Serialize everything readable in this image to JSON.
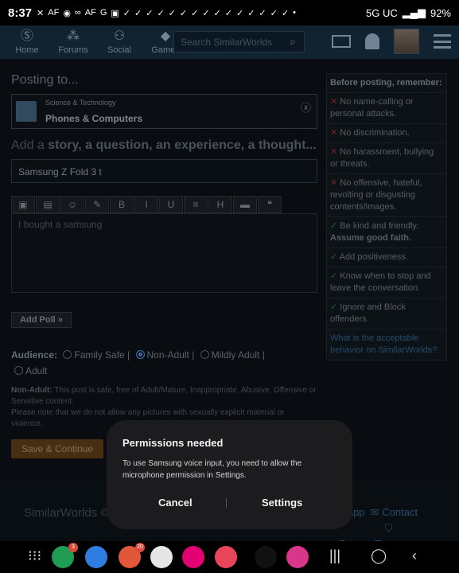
{
  "status_bar": {
    "time": "8:37",
    "notif_icons": [
      "✕",
      "AF",
      "◉",
      "∞",
      "AF",
      "G",
      "▣",
      "✓",
      "✓",
      "✓",
      "✓",
      "✓",
      "✓",
      "✓",
      "✓",
      "✓",
      "✓",
      "✓",
      "✓",
      "✓",
      "✓",
      "✓",
      "•"
    ],
    "network": "5G UC",
    "battery": "92%"
  },
  "nav": {
    "items": [
      {
        "label": "Home",
        "icon": "logo-icon"
      },
      {
        "label": "Forums",
        "icon": "forums-icon"
      },
      {
        "label": "Social",
        "icon": "social-icon"
      },
      {
        "label": "Games",
        "icon": "games-icon"
      }
    ],
    "search_placeholder": "Search SimilarWorlds"
  },
  "post": {
    "posting_to": "Posting to...",
    "group_category": "Science & Technology",
    "group_name": "Phones & Computers",
    "prompt_lead": "Add a ",
    "prompt_bold": "story, a question, an experience, a thought...",
    "title_value": "Samsung Z Fold 3 t",
    "toolbar": [
      "▣",
      "▤",
      "☺",
      "✎",
      "B",
      "I",
      "U",
      "≡",
      "H",
      "▬",
      "❝"
    ],
    "body_value": "I bought a samsung",
    "add_poll": "Add Poll »",
    "audience_label": "Audience:",
    "audience_options": [
      "Family Safe |",
      "Non-Adult |",
      "Mildly Adult |",
      "Adult"
    ],
    "audience_selected": "Non-Adult",
    "note_bold": "Non-Adult:",
    "note_text": " This post is safe, free of Adult/Mature, Inappropriate, Abusive, Offensive or Sensitive content.",
    "note_text2": "Please note that we do not allow any pictures with sexually explicit material or violence.",
    "save_button": "Save & Continue"
  },
  "sidebar": {
    "header": "Before posting, remember:",
    "rules": [
      {
        "mark": "✕",
        "type": "no",
        "text": "No name-calling or personal attacks."
      },
      {
        "mark": "✕",
        "type": "no",
        "text": "No discrimination."
      },
      {
        "mark": "✕",
        "type": "no",
        "text": "No harassment, bullying or threats."
      },
      {
        "mark": "✕",
        "type": "no",
        "text": "No offensive, hateful, revolting or disgusting contents/images."
      },
      {
        "mark": "✓",
        "type": "yes",
        "text": "Be kind and friendly.",
        "bold": "Assume good faith."
      },
      {
        "mark": "✓",
        "type": "yes",
        "text": "Add positiveness."
      },
      {
        "mark": "✓",
        "type": "yes",
        "text": "Know when to stop and leave the conversation."
      },
      {
        "mark": "✓",
        "type": "yes",
        "text": "Ignore and Block offenders."
      }
    ],
    "link": "What is the acceptable behavior on SimilarWorlds?"
  },
  "footer": {
    "brand": "SimilarWorlds ©",
    "link1": "s App",
    "link2": "Contact",
    "link3": "Privacy/Terms"
  },
  "dialog": {
    "title": "Permissions needed",
    "body": "To use Samsung voice input, you need to allow the microphone permission in Settings.",
    "cancel": "Cancel",
    "settings": "Settings"
  },
  "bottom_apps": [
    {
      "name": "phone-app-icon",
      "color": "#1f9d55",
      "badge": "3"
    },
    {
      "name": "messages-app-icon",
      "color": "#2f7de1",
      "badge": ""
    },
    {
      "name": "brave-app-icon",
      "color": "#e2573a",
      "badge": "20"
    },
    {
      "name": "play-store-app-icon",
      "color": "#e6e6e6",
      "badge": ""
    },
    {
      "name": "tmobile-app-icon",
      "color": "#e20074",
      "badge": ""
    },
    {
      "name": "camera-app-icon",
      "color": "#e8445a",
      "badge": ""
    },
    {
      "name": "x-app-icon",
      "color": "#111111",
      "badge": ""
    },
    {
      "name": "flower-app-icon",
      "color": "#d8368a",
      "badge": ""
    }
  ]
}
